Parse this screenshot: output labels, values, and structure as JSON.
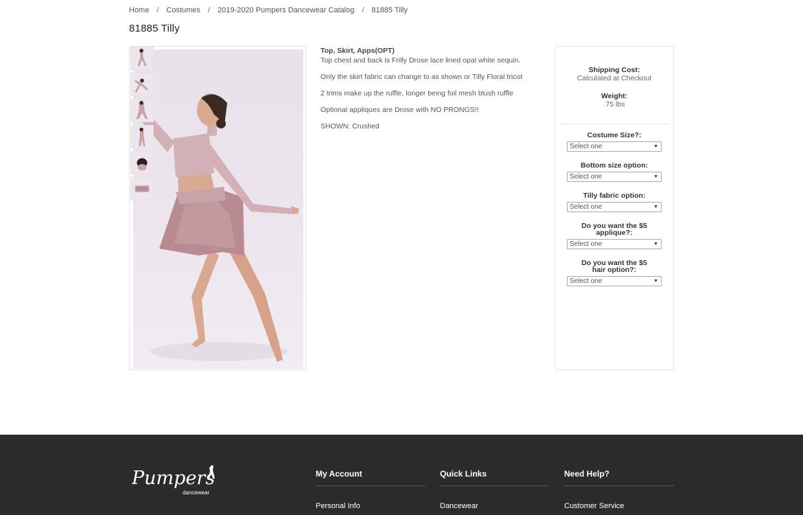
{
  "breadcrumb": [
    "Home",
    "Costumes",
    "2019-2020 Pumpers Dancewear Catalog",
    "81885 Tilly"
  ],
  "breadcrumb_separator": "/",
  "product": {
    "title": "81885 Tilly",
    "heading": "Top, Skirt, Apps(OPT)",
    "description": [
      "Top chest and back is Frilly Drose lace lined opal white sequin.",
      "Only the skirt fabric can change to as shown or Tilly Floral tricot",
      "2 trims make up the ruffle, longer being foil mesh blush ruffle",
      "Optional appliques are Drose with NO PRONGS!!",
      "SHOWN: Crushed"
    ]
  },
  "gallery": {
    "thumbnail_count": 6
  },
  "sidebar": {
    "shipping_label": "Shipping Cost:",
    "shipping_value": "Calculated at Checkout",
    "weight_label": "Weight:",
    "weight_value": ".75 lbs",
    "options": [
      {
        "label": "Costume Size?:",
        "selected": "Select one"
      },
      {
        "label": "Bottom size option:",
        "selected": "Select one"
      },
      {
        "label": "Tilly fabric option:",
        "selected": "Select one"
      },
      {
        "label": "Do you want the $5 applique?:",
        "selected": "Select one"
      },
      {
        "label": "Do you want the $5 hair option?:",
        "selected": "Select one"
      }
    ]
  },
  "footer": {
    "logo_text": "Pumpers",
    "logo_subtext": "dancewear",
    "columns": [
      {
        "title": "My Account",
        "link": "Personal Info"
      },
      {
        "title": "Quick Links",
        "link": "Dancewear"
      },
      {
        "title": "Need Help?",
        "link": "Customer Service"
      }
    ]
  },
  "colors": {
    "footer_bg": "#2b2b2b",
    "costume": "#c9a2a8",
    "photo_bg": "#ece5ee"
  }
}
